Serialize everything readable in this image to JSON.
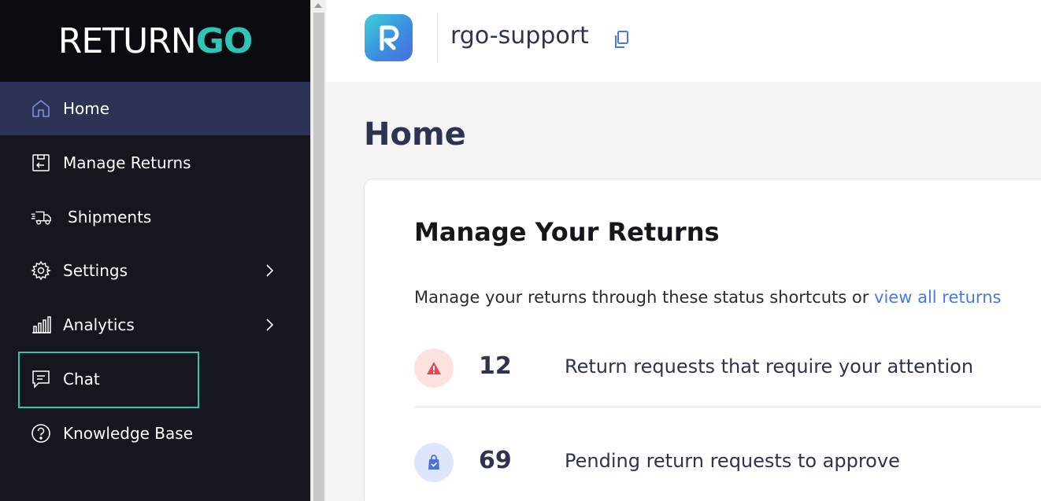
{
  "sidebar": {
    "logo_part1": "RETURN",
    "logo_part2": "GO",
    "items": [
      {
        "label": "Home",
        "icon": "home-icon"
      },
      {
        "label": "Manage Returns",
        "icon": "return-box-icon"
      },
      {
        "label": "Shipments",
        "icon": "truck-icon"
      },
      {
        "label": "Settings",
        "icon": "gear-icon"
      },
      {
        "label": "Analytics",
        "icon": "bar-chart-icon"
      },
      {
        "label": "Chat",
        "icon": "chat-icon"
      },
      {
        "label": "Knowledge Base",
        "icon": "help-circle-icon"
      }
    ],
    "active_item": "Home",
    "focused_item": "Chat"
  },
  "header": {
    "store_name": "rgo-support",
    "copy_icon": "copy-icon"
  },
  "main": {
    "page_title": "Home",
    "card": {
      "title": "Manage Your Returns",
      "subtitle": "Manage your returns through these status shortcuts or ",
      "subtitle_link": "view all returns",
      "rows": [
        {
          "count": "12",
          "description": "Return requests that require your attention",
          "icon": "warning-icon"
        },
        {
          "count": "69",
          "description": "Pending return requests to approve",
          "icon": "shopping-bag-icon"
        }
      ]
    }
  },
  "colors": {
    "sidebar_bg": "#16161f",
    "active_bg": "#2c3354",
    "accent_teal": "#2ec4b6",
    "link_blue": "#4a7ae0",
    "text_navy": "#2d3350",
    "warning_bg": "#fde1e1",
    "warning_fg": "#e5484d",
    "pending_bg": "#dde6fb",
    "pending_fg": "#4a6fe0"
  }
}
